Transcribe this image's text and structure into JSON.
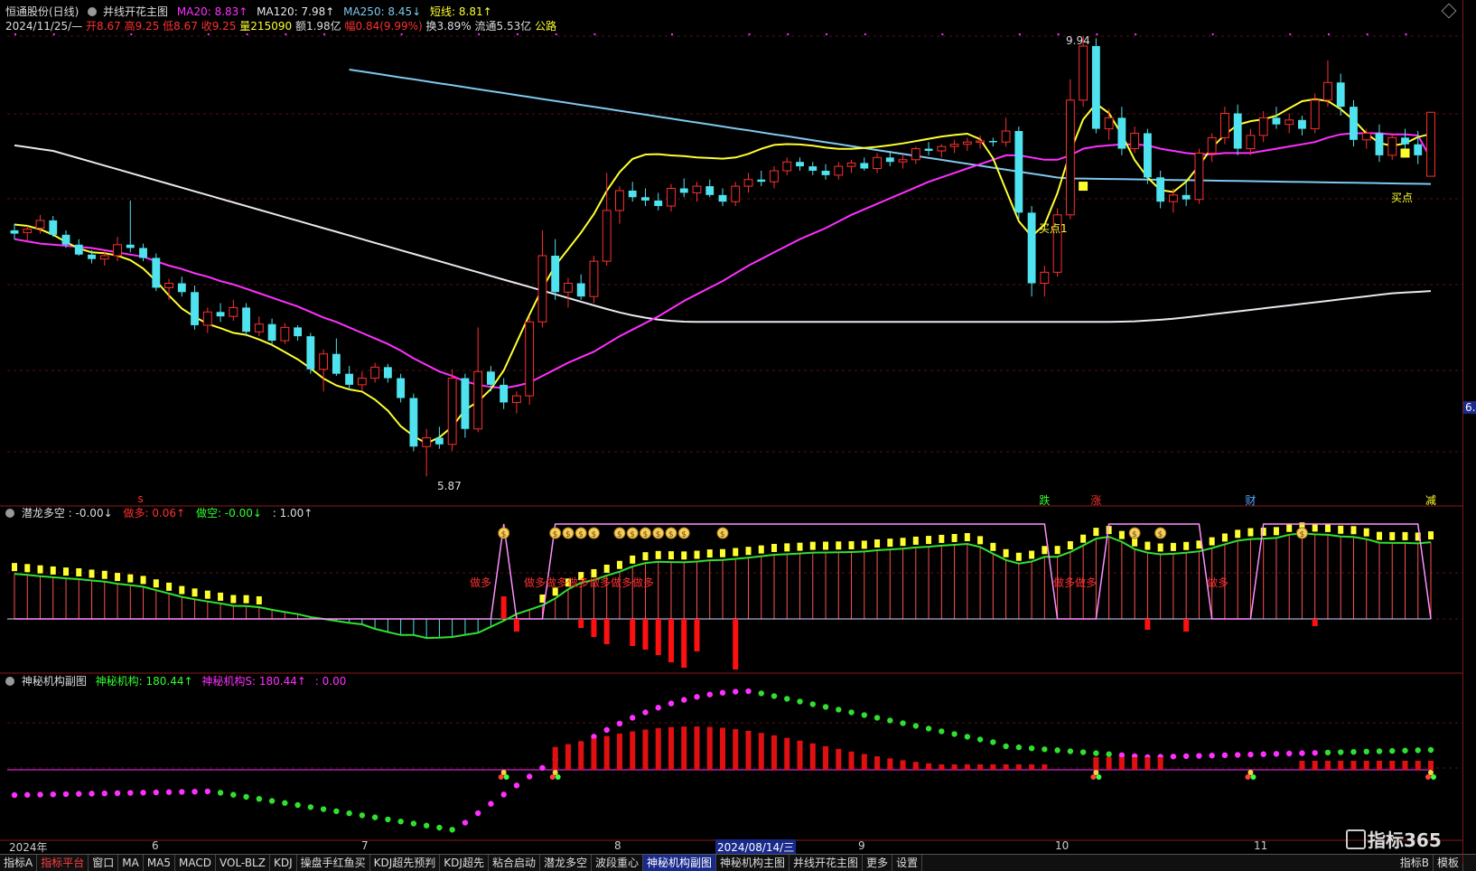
{
  "header": {
    "stock": "恒通股份(日线)",
    "indicator": "并线开花主图",
    "ma20": "MA20: 8.83↑",
    "ma120": "MA120: 7.98↑",
    "ma250": "MA250: 8.45↓",
    "short_line": "短线: 8.81↑",
    "quote_date": "2024/11/25/—",
    "quote_open": "开8.67",
    "quote_high": "高9.25",
    "quote_low": "低8.67",
    "quote_close": "收9.25",
    "quote_volume": "量215090",
    "quote_amount": "额1.98亿",
    "quote_change": "幅0.84(9.99%)",
    "quote_turnover": "换3.89%",
    "quote_float": "流通5.53亿",
    "quote_status": "公路"
  },
  "panel2": {
    "title": "潜龙多空",
    "main_val": ": -0.00↓",
    "long_label": "做多: 0.06↑",
    "short_label": "做空: -0.00↓",
    "extra": ": 1.00↑"
  },
  "panel3": {
    "title": "神秘机构副图",
    "v1": "神秘机构: 180.44↑",
    "v2": "神秘机构S: 180.44↑",
    "v3": ": 0.00"
  },
  "annotations": {
    "high_price": "9.94",
    "low_price": "5.87",
    "buy_point1": "买点1",
    "buy_point": "买点",
    "right_value": "6.",
    "signal_die": "跌",
    "signal_zhang": "涨",
    "signal_cai": "财",
    "signal_jian": "减",
    "signal_left": "s",
    "zuoduo": "做多",
    "zuoduo_group1": "做多做多做多做多做多做多",
    "zuoduo_group2": "做多做多",
    "zuoduo_group3": "做多"
  },
  "time_axis": {
    "labels": [
      "2024年",
      "6",
      "7",
      "8",
      "9",
      "10",
      "11"
    ],
    "cursor_date": "2024/08/14/三"
  },
  "toolbar": {
    "buttons": [
      "指标A",
      "指标平台",
      "窗口",
      "MA",
      "MA5",
      "MACD",
      "VOL-BLZ",
      "KDJ",
      "操盘手红鱼买",
      "KDJ超先预判",
      "KDJ超先",
      "粘合启动",
      "潜龙多空",
      "波段重心",
      "神秘机构副图",
      "神秘机构主图",
      "并线开花主图",
      "更多",
      "设置"
    ],
    "right_buttons": [
      "指标B",
      "模板"
    ]
  },
  "brand": "指标365",
  "colors": {
    "up": "#ff3030",
    "down": "#4fe3f0",
    "ma20": "#ff30ff",
    "ma120": "#e8e8f0",
    "ma250": "#7fc8ee",
    "short": "#ffff30"
  },
  "chart_data": {
    "type": "candlestick",
    "price_high_label": 9.94,
    "price_low_label": 5.87,
    "candles": [
      [
        8.18,
        8.24,
        8.1,
        8.15
      ],
      [
        8.16,
        8.22,
        8.08,
        8.19
      ],
      [
        8.2,
        8.32,
        8.15,
        8.27
      ],
      [
        8.27,
        8.31,
        8.12,
        8.14
      ],
      [
        8.14,
        8.18,
        8.02,
        8.05
      ],
      [
        8.05,
        8.1,
        7.95,
        7.96
      ],
      [
        7.96,
        8.0,
        7.88,
        7.92
      ],
      [
        7.92,
        7.99,
        7.86,
        7.95
      ],
      [
        7.95,
        8.12,
        7.9,
        8.05
      ],
      [
        8.05,
        8.45,
        7.98,
        8.02
      ],
      [
        8.02,
        8.06,
        7.9,
        7.93
      ],
      [
        7.93,
        7.97,
        7.63,
        7.66
      ],
      [
        7.66,
        7.74,
        7.55,
        7.7
      ],
      [
        7.7,
        7.76,
        7.58,
        7.62
      ],
      [
        7.62,
        7.68,
        7.28,
        7.32
      ],
      [
        7.32,
        7.48,
        7.25,
        7.44
      ],
      [
        7.44,
        7.52,
        7.35,
        7.4
      ],
      [
        7.4,
        7.55,
        7.36,
        7.48
      ],
      [
        7.48,
        7.52,
        7.22,
        7.26
      ],
      [
        7.26,
        7.4,
        7.22,
        7.33
      ],
      [
        7.33,
        7.38,
        7.14,
        7.18
      ],
      [
        7.18,
        7.34,
        7.15,
        7.3
      ],
      [
        7.3,
        7.32,
        7.18,
        7.22
      ],
      [
        7.22,
        7.25,
        6.88,
        6.92
      ],
      [
        6.92,
        7.1,
        6.72,
        7.06
      ],
      [
        7.06,
        7.2,
        6.86,
        6.88
      ],
      [
        6.88,
        6.95,
        6.73,
        6.78
      ],
      [
        6.78,
        6.9,
        6.72,
        6.84
      ],
      [
        6.84,
        6.98,
        6.8,
        6.94
      ],
      [
        6.94,
        6.97,
        6.8,
        6.84
      ],
      [
        6.84,
        6.88,
        6.62,
        6.66
      ],
      [
        6.66,
        6.7,
        6.18,
        6.22
      ],
      [
        6.22,
        6.38,
        5.95,
        6.3
      ],
      [
        6.3,
        6.4,
        6.2,
        6.24
      ],
      [
        6.24,
        6.92,
        6.18,
        6.84
      ],
      [
        6.84,
        6.88,
        6.3,
        6.38
      ],
      [
        6.38,
        7.3,
        6.35,
        6.9
      ],
      [
        6.9,
        6.95,
        6.72,
        6.78
      ],
      [
        6.78,
        6.84,
        6.56,
        6.62
      ],
      [
        6.62,
        6.72,
        6.52,
        6.68
      ],
      [
        6.68,
        7.4,
        6.6,
        7.35
      ],
      [
        7.35,
        8.18,
        7.3,
        7.95
      ],
      [
        7.95,
        8.1,
        7.55,
        7.62
      ],
      [
        7.62,
        7.75,
        7.48,
        7.7
      ],
      [
        7.7,
        7.78,
        7.55,
        7.58
      ],
      [
        7.58,
        7.95,
        7.52,
        7.9
      ],
      [
        7.9,
        8.7,
        7.86,
        8.36
      ],
      [
        8.36,
        8.58,
        8.24,
        8.54
      ],
      [
        8.54,
        8.62,
        8.44,
        8.48
      ],
      [
        8.48,
        8.56,
        8.4,
        8.45
      ],
      [
        8.45,
        8.52,
        8.36,
        8.4
      ],
      [
        8.4,
        8.6,
        8.35,
        8.56
      ],
      [
        8.56,
        8.65,
        8.48,
        8.52
      ],
      [
        8.52,
        8.62,
        8.44,
        8.58
      ],
      [
        8.58,
        8.64,
        8.48,
        8.5
      ],
      [
        8.5,
        8.56,
        8.4,
        8.44
      ],
      [
        8.44,
        8.62,
        8.4,
        8.58
      ],
      [
        8.58,
        8.7,
        8.52,
        8.64
      ],
      [
        8.64,
        8.72,
        8.58,
        8.62
      ],
      [
        8.62,
        8.76,
        8.56,
        8.72
      ],
      [
        8.72,
        8.84,
        8.68,
        8.8
      ],
      [
        8.8,
        8.84,
        8.72,
        8.76
      ],
      [
        8.76,
        8.8,
        8.68,
        8.72
      ],
      [
        8.72,
        8.78,
        8.64,
        8.68
      ],
      [
        8.68,
        8.8,
        8.64,
        8.76
      ],
      [
        8.76,
        8.82,
        8.7,
        8.79
      ],
      [
        8.79,
        8.84,
        8.72,
        8.74
      ],
      [
        8.74,
        8.88,
        8.7,
        8.84
      ],
      [
        8.84,
        8.9,
        8.76,
        8.8
      ],
      [
        8.8,
        8.86,
        8.74,
        8.82
      ],
      [
        8.82,
        8.94,
        8.78,
        8.92
      ],
      [
        8.92,
        8.98,
        8.86,
        8.9
      ],
      [
        8.9,
        8.96,
        8.84,
        8.94
      ],
      [
        8.94,
        9.0,
        8.88,
        8.96
      ],
      [
        8.96,
        9.02,
        8.9,
        8.98
      ],
      [
        8.98,
        9.04,
        8.92,
        8.99
      ],
      [
        8.99,
        9.02,
        8.94,
        8.98
      ],
      [
        8.98,
        9.2,
        8.94,
        9.08
      ],
      [
        9.08,
        9.12,
        8.28,
        8.34
      ],
      [
        8.34,
        8.4,
        7.58,
        7.7
      ],
      [
        7.7,
        7.86,
        7.58,
        7.8
      ],
      [
        7.8,
        8.38,
        7.76,
        8.32
      ],
      [
        8.32,
        9.55,
        8.28,
        9.36
      ],
      [
        9.36,
        9.94,
        9.3,
        9.85
      ],
      [
        9.85,
        9.92,
        9.06,
        9.1
      ],
      [
        9.1,
        9.28,
        9.0,
        9.2
      ],
      [
        9.2,
        9.3,
        8.86,
        8.92
      ],
      [
        8.92,
        9.12,
        8.88,
        9.06
      ],
      [
        9.06,
        9.1,
        8.6,
        8.66
      ],
      [
        8.66,
        8.72,
        8.38,
        8.44
      ],
      [
        8.44,
        8.56,
        8.34,
        8.5
      ],
      [
        8.5,
        8.62,
        8.4,
        8.46
      ],
      [
        8.46,
        8.92,
        8.42,
        8.88
      ],
      [
        8.88,
        9.06,
        8.8,
        9.02
      ],
      [
        9.02,
        9.3,
        8.96,
        9.24
      ],
      [
        9.24,
        9.32,
        8.86,
        8.92
      ],
      [
        8.92,
        9.1,
        8.86,
        9.04
      ],
      [
        9.04,
        9.26,
        8.98,
        9.2
      ],
      [
        9.2,
        9.3,
        9.1,
        9.14
      ],
      [
        9.14,
        9.24,
        9.06,
        9.18
      ],
      [
        9.18,
        9.22,
        9.04,
        9.1
      ],
      [
        9.1,
        9.42,
        9.06,
        9.36
      ],
      [
        9.36,
        9.72,
        9.3,
        9.52
      ],
      [
        9.52,
        9.6,
        9.22,
        9.3
      ],
      [
        9.3,
        9.36,
        8.94,
        9.0
      ],
      [
        9.0,
        9.1,
        8.92,
        9.06
      ],
      [
        9.06,
        9.14,
        8.8,
        8.86
      ],
      [
        8.86,
        9.06,
        8.82,
        9.02
      ],
      [
        9.02,
        9.1,
        8.92,
        8.96
      ],
      [
        8.96,
        9.08,
        8.78,
        8.86
      ],
      [
        8.67,
        9.25,
        8.67,
        9.25
      ]
    ],
    "ma20": [
      8.1,
      8.08,
      8.06,
      8.05,
      8.04,
      8.03,
      8.02,
      8.0,
      7.98,
      7.96,
      7.94,
      7.9,
      7.86,
      7.83,
      7.79,
      7.76,
      7.72,
      7.69,
      7.65,
      7.61,
      7.57,
      7.53,
      7.49,
      7.44,
      7.39,
      7.35,
      7.3,
      7.25,
      7.2,
      7.15,
      7.09,
      7.02,
      6.96,
      6.9,
      6.86,
      6.81,
      6.78,
      6.76,
      6.75,
      6.77,
      6.8,
      6.86,
      6.92,
      6.98,
      7.03,
      7.08,
      7.15,
      7.22,
      7.28,
      7.34,
      7.4,
      7.47,
      7.54,
      7.6,
      7.66,
      7.72,
      7.79,
      7.86,
      7.92,
      7.98,
      8.04,
      8.1,
      8.15,
      8.2,
      8.26,
      8.32,
      8.37,
      8.42,
      8.47,
      8.52,
      8.57,
      8.62,
      8.66,
      8.7,
      8.74,
      8.78,
      8.82,
      8.86,
      8.86,
      8.84,
      8.82,
      8.82,
      8.86,
      8.92,
      8.94,
      8.95,
      8.96,
      8.96,
      8.95,
      8.92,
      8.9,
      8.88,
      8.87,
      8.87,
      8.88,
      8.88,
      8.88,
      8.9,
      8.92,
      8.94,
      8.96,
      8.98,
      9.02,
      9.05,
      9.06,
      9.06,
      9.06,
      9.05,
      9.05,
      9.04,
      8.83
    ],
    "signals": [
      {
        "i": 10,
        "label": "s",
        "color": "#ff3030"
      },
      {
        "i": 80,
        "label": "跌",
        "color": "#30ff30"
      },
      {
        "i": 84,
        "label": "涨",
        "color": "#ff3030"
      },
      {
        "i": 96,
        "label": "财",
        "color": "#4fa8ff"
      },
      {
        "i": 110,
        "label": "减",
        "color": "#ffff30"
      }
    ]
  }
}
